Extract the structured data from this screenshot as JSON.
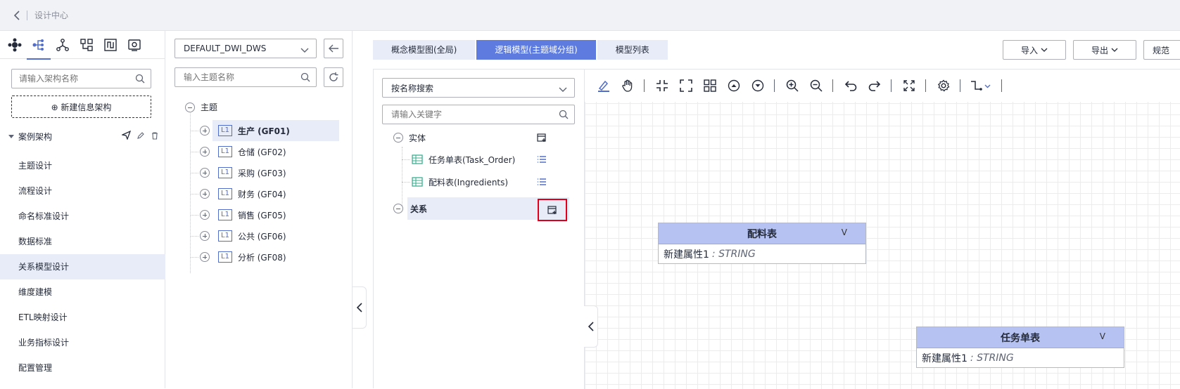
{
  "header": {
    "breadcrumb": "设计中心"
  },
  "sidebar": {
    "search_placeholder": "请输入架构名称",
    "new_button": "⊕ 新建信息架构",
    "tree_title": "案例架构",
    "items": [
      {
        "label": "主题设计"
      },
      {
        "label": "流程设计"
      },
      {
        "label": "命名标准设计"
      },
      {
        "label": "数据标准"
      },
      {
        "label": "关系模型设计",
        "active": true
      },
      {
        "label": "维度建模"
      },
      {
        "label": "ETL映射设计"
      },
      {
        "label": "业务指标设计"
      },
      {
        "label": "配置管理"
      }
    ]
  },
  "subject": {
    "select_value": "DEFAULT_DWI_DWS",
    "search_placeholder": "输入主题名称",
    "root": "主题",
    "level_tag": "L1",
    "items": [
      {
        "label": "生产 (GF01)",
        "active": true
      },
      {
        "label": "仓储 (GF02)"
      },
      {
        "label": "采购 (GF03)"
      },
      {
        "label": "财务 (GF04)"
      },
      {
        "label": "销售 (GF05)"
      },
      {
        "label": "公共 (GF06)"
      },
      {
        "label": "分析 (GF08)"
      }
    ]
  },
  "tabs": [
    {
      "label": "概念模型图(全局)"
    },
    {
      "label": "逻辑模型(主题域分组)",
      "active": true
    },
    {
      "label": "模型列表"
    }
  ],
  "top_buttons": {
    "import": "导入",
    "export": "导出",
    "spec": "规范"
  },
  "entity_panel": {
    "search_mode": "按名称搜索",
    "keyword_placeholder": "请输入关键字",
    "entity_group": "实体",
    "entities": [
      "任务单表(Task_Order)",
      "配料表(Ingredients)"
    ],
    "relation_group": "关系"
  },
  "canvas": {
    "entities": [
      {
        "title": "配料表",
        "attr": "新建属性1",
        "type": ": STRING",
        "toggle": "V"
      },
      {
        "title": "任务单表",
        "attr": "新建属性1",
        "type": ": STRING",
        "toggle": "V"
      }
    ]
  },
  "colors": {
    "accent": "#5e7ce0",
    "highlight": "#e0001b",
    "entity_header": "#b6c3f2"
  }
}
